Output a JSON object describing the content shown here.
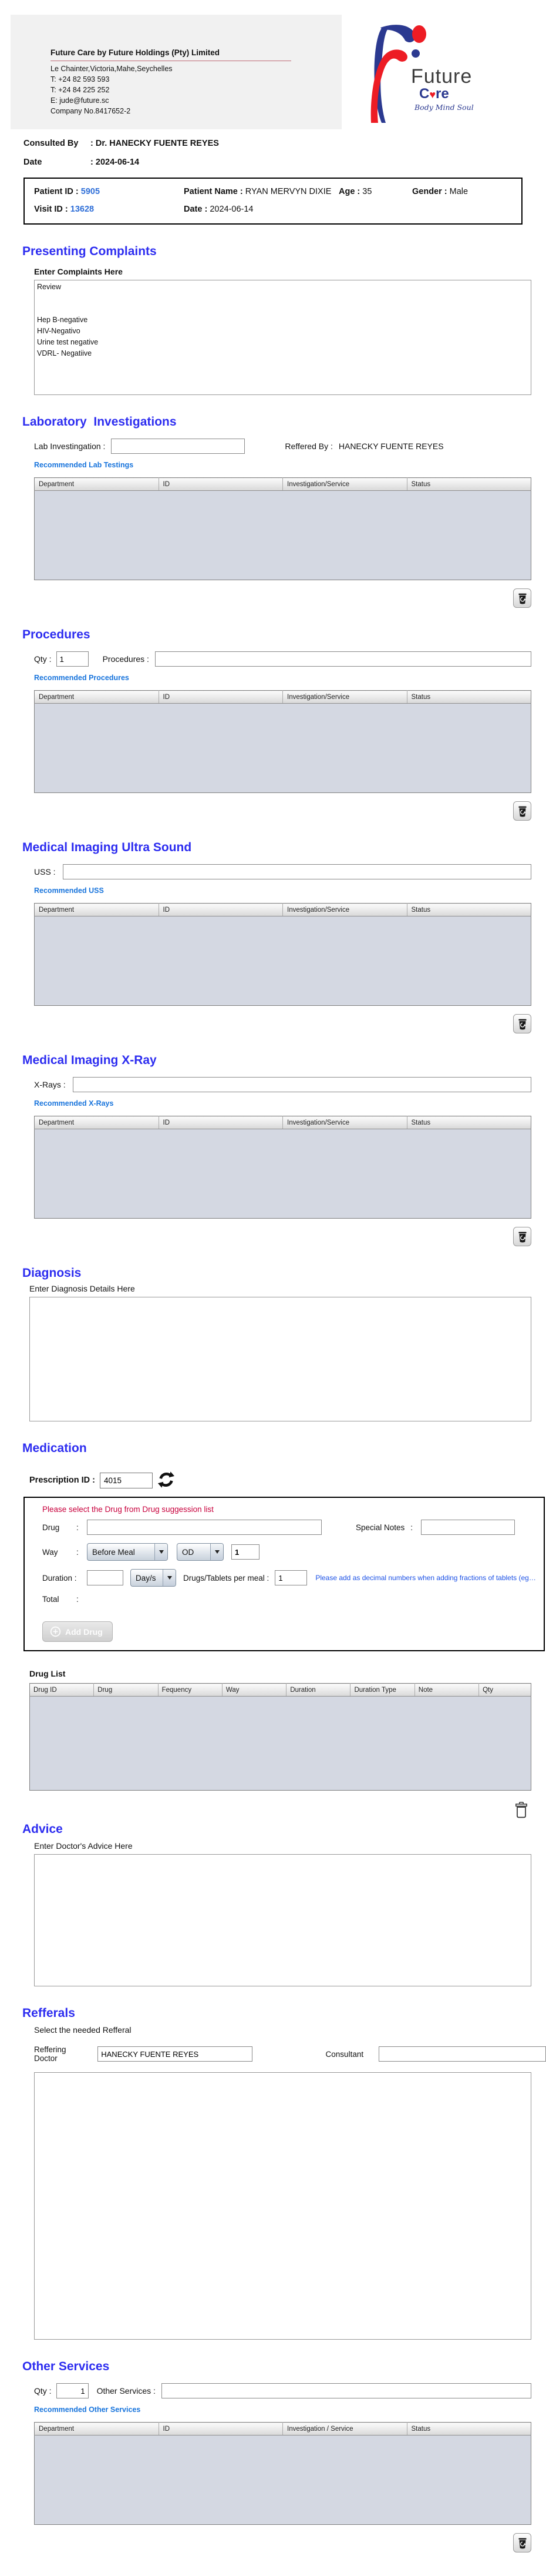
{
  "colors": {
    "heading_blue": "#2d2df0",
    "link_blue": "#1874dc",
    "id_blue": "#2f6fd8",
    "note_red": "#c8003c",
    "note_blue": "#1a50e6",
    "table_body": "#d4d8e2",
    "logo_blue": "#2b3990",
    "logo_red": "#ed1c24"
  },
  "company": {
    "name_line": "Future Care by Future Holdings (Pty) Limited",
    "address": "Le Chainter,Victoria,Mahe,Seychelles",
    "phone1": "T: +24  82 593 593",
    "phone2": "T: +24  84 225 252",
    "email": "E: jude@future.sc",
    "company_no": "Company No.8417652-2",
    "logo_word1": "Future",
    "logo_word2_pre": "C",
    "logo_word2_heart": "♥",
    "logo_word2_post": "re",
    "logo_tagline": "Body Mind Soul"
  },
  "consultation": {
    "consulted_by_label": "Consulted By",
    "colon": ":",
    "consulted_by_value": "Dr.  HANECKY FUENTE REYES",
    "date_label": "Date",
    "date_value": "2024-06-14"
  },
  "patient": {
    "patient_id_label": "Patient ID :",
    "patient_id": "5905",
    "patient_name_label": "Patient Name :",
    "patient_name": "RYAN MERVYN DIXIE",
    "age_label": "Age :",
    "age": "35",
    "gender_label": "Gender  :",
    "gender": "Male",
    "visit_id_label": "Visit ID    :",
    "visit_id": "13628",
    "visit_date_label": "Date            :",
    "visit_date": "2024-06-14"
  },
  "presenting_complaints": {
    "title": "Presenting Complaints",
    "subtitle": "Enter Complaints Here",
    "text": "Review\n\n\nHep B-negative\nHIV-Negativo\nUrine test negative\nVDRL- Negatiive"
  },
  "laboratory": {
    "title": "Laboratory  Investigations",
    "input_label": "Lab Investingation :",
    "input_value": "",
    "referred_by_label": "Reffered By :",
    "referred_by_value": "HANECKY FUENTE REYES",
    "link": "Recommended Lab Testings",
    "table_headers": [
      "Department",
      "ID",
      "Investigation/Service",
      "Status"
    ]
  },
  "procedures": {
    "title": "Procedures",
    "qty_label": "Qty :",
    "qty_value": "1",
    "input_label": "Procedures :",
    "input_value": "",
    "link": "Recommended Procedures",
    "table_headers": [
      "Department",
      "ID",
      "Investigation/Service",
      "Status"
    ]
  },
  "ultrasound": {
    "title": "Medical Imaging Ultra Sound",
    "input_label": "USS :",
    "input_value": "",
    "link": "Recommended USS",
    "table_headers": [
      "Department",
      "ID",
      "Investigation/Service",
      "Status"
    ]
  },
  "xray": {
    "title": "Medical Imaging X-Ray",
    "input_label": "X-Rays :",
    "input_value": "",
    "link": "Recommended X-Rays",
    "table_headers": [
      "Department",
      "ID",
      "Investigation/Service",
      "Status"
    ]
  },
  "diagnosis": {
    "title": "Diagnosis",
    "subtitle": "Enter Diagnosis Details Here",
    "text": ""
  },
  "medication": {
    "title": "Medication",
    "prescription_id_label": "Prescription ID :",
    "prescription_id": "4015",
    "panel_note": "Please select the Drug from Drug suggession list",
    "colon": ":",
    "drug_label": "Drug",
    "drug_value": "",
    "special_notes_label": "Special Notes",
    "special_notes_value": "",
    "way_label": "Way",
    "way_value": "Before Meal",
    "frequency_value": "OD",
    "way_qty_value": "1",
    "duration_label": "Duration :",
    "duration_value": "",
    "duration_unit_value": "Day/s",
    "per_meal_label": "Drugs/Tablets per meal :",
    "per_meal_value": "1",
    "fraction_note": "Please add as decimal numbers when adding fractions of tablets (eg…",
    "total_label": "Total",
    "add_drug_label": "Add Drug",
    "drug_list_title": "Drug List",
    "drug_table_headers": [
      "Drug ID",
      "Drug",
      "Fequency",
      "Way",
      "Duration",
      "Duration Type",
      "Note",
      "Qty"
    ]
  },
  "advice": {
    "title": "Advice",
    "subtitle": "Enter Doctor's Advice Here",
    "text": ""
  },
  "referrals": {
    "title": "Refferals",
    "subtitle": "Select the needed Refferal",
    "referring_doctor_label": "Reffering Doctor",
    "referring_doctor_value": "HANECKY FUENTE REYES",
    "consultant_label": "Consultant",
    "consultant_value": ""
  },
  "other_services": {
    "title": "Other Services",
    "qty_label": "Qty :",
    "qty_value": "1",
    "input_label": "Other Services :",
    "input_value": "",
    "link": "Recommended Other Services",
    "table_headers": [
      "Department",
      "ID",
      "Investigation / Service",
      "Status"
    ]
  }
}
